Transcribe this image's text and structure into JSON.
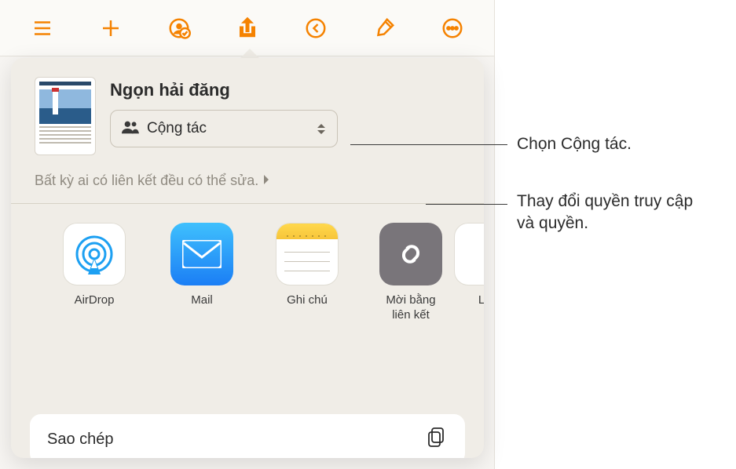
{
  "toolbar": {
    "icons": [
      "list-icon",
      "add-icon",
      "collab-badge-icon",
      "share-icon",
      "undo-icon",
      "brush-icon",
      "more-icon"
    ]
  },
  "doc": {
    "title": "Ngọn hải đăng"
  },
  "collab": {
    "label": "Cộng tác"
  },
  "permissions": {
    "text": "Bất kỳ ai có liên kết đều có thể sửa."
  },
  "apps": {
    "airdrop": "AirDrop",
    "mail": "Mail",
    "notes": "Ghi chú",
    "invite_link": "Mời bằng\nliên kết",
    "reminders_partial": "Lờ"
  },
  "actions": {
    "copy": "Sao chép"
  },
  "callouts": {
    "collab": "Chọn Cộng tác.",
    "permissions": "Thay đổi quyền truy cập và quyền."
  }
}
